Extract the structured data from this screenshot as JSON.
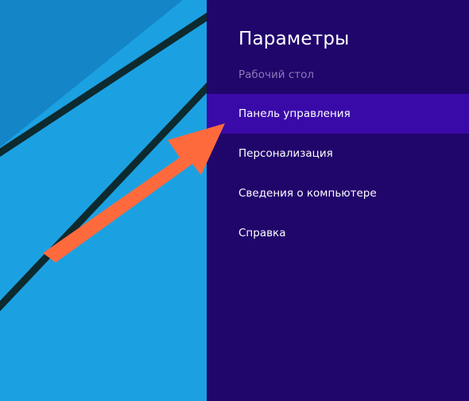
{
  "desktop": {
    "background_color": "#1ba1e2",
    "stripe_color": "#0d2a2e",
    "shade_color": "#0f6fb0"
  },
  "charm_panel": {
    "title": "Параметры",
    "context_label": "Рабочий стол",
    "background_color": "#20056b",
    "context_color": "#8a7bb8",
    "highlight_color": "#3a0aa8",
    "items": [
      {
        "label": "Панель управления",
        "highlighted": true
      },
      {
        "label": "Персонализация",
        "highlighted": false
      },
      {
        "label": "Сведения о компьютере",
        "highlighted": false
      },
      {
        "label": "Справка",
        "highlighted": false
      }
    ]
  },
  "annotation": {
    "arrow_color": "#ff6a3d",
    "arrow_target": "Панель управления"
  }
}
